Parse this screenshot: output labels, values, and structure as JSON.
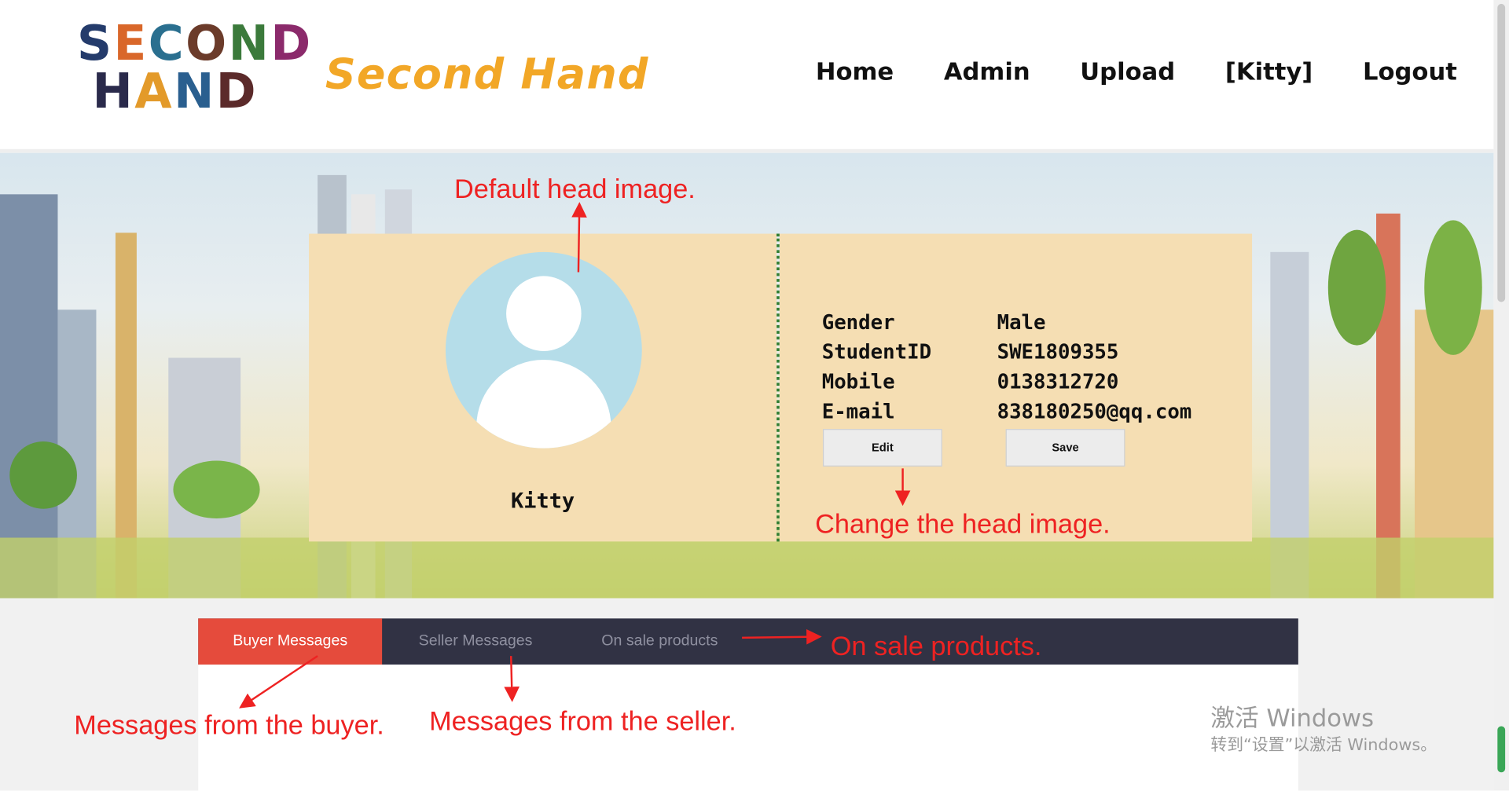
{
  "header": {
    "logo": {
      "line1": "SECOND",
      "line2": "HAND"
    },
    "brand": "Second Hand",
    "nav": [
      {
        "label": "Home"
      },
      {
        "label": "Admin"
      },
      {
        "label": "Upload"
      },
      {
        "label": "[Kitty]"
      },
      {
        "label": "Logout"
      }
    ]
  },
  "profile": {
    "username": "Kitty",
    "fields": [
      {
        "label": "Gender",
        "value": "Male"
      },
      {
        "label": "StudentID",
        "value": "SWE1809355"
      },
      {
        "label": "Mobile",
        "value": "0138312720"
      },
      {
        "label": "E-mail",
        "value": "838180250@qq.com"
      }
    ],
    "edit_label": "Edit",
    "save_label": "Save"
  },
  "tabs": [
    {
      "label": "Buyer Messages",
      "active": true
    },
    {
      "label": "Seller Messages",
      "active": false
    },
    {
      "label": "On sale products",
      "active": false
    }
  ],
  "annotations": {
    "default_head": "Default head image.",
    "change_head": "Change the head image.",
    "on_sale": "On sale products.",
    "buyer": "Messages from the buyer.",
    "seller": "Messages from the seller."
  },
  "watermark": {
    "line1": "激活 Windows",
    "line2": "转到“设置”以激活 Windows。"
  },
  "colors": {
    "brand": "#f2a727",
    "card": "#f5deb3",
    "avatar": "#b5dde9",
    "tab_active": "#e54b3c",
    "tab_bar": "#313244",
    "annotation": "#ee2222"
  }
}
